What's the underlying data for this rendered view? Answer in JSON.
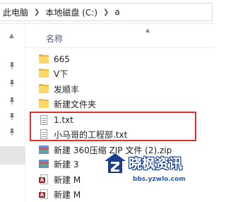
{
  "addressbar": {
    "crumbs": [
      "此电脑",
      "本地磁盘 (C:)",
      "a"
    ]
  },
  "list": {
    "column_name": "名称",
    "items": [
      {
        "name": "665",
        "type": "folder"
      },
      {
        "name": "V下",
        "type": "folder"
      },
      {
        "name": "发顺丰",
        "type": "folder"
      },
      {
        "name": "新建文件夹",
        "type": "folder"
      },
      {
        "name": "1.txt",
        "type": "txt"
      },
      {
        "name": "小马哥的工程部.txt",
        "type": "txt"
      },
      {
        "name": "新建 360压缩 ZIP 文件 (2).zip",
        "type": "zip"
      },
      {
        "name": "新建 3",
        "type": "zip"
      },
      {
        "name": "新建 M",
        "type": "access"
      },
      {
        "name": "新建 M",
        "type": "access"
      }
    ]
  },
  "watermark": {
    "title": "晓枫资讯",
    "url": "bbs.yzwlo.com"
  },
  "colors": {
    "highlight": "#e0302b",
    "folder": "#ffd868",
    "selection": "#e5e5e5"
  }
}
